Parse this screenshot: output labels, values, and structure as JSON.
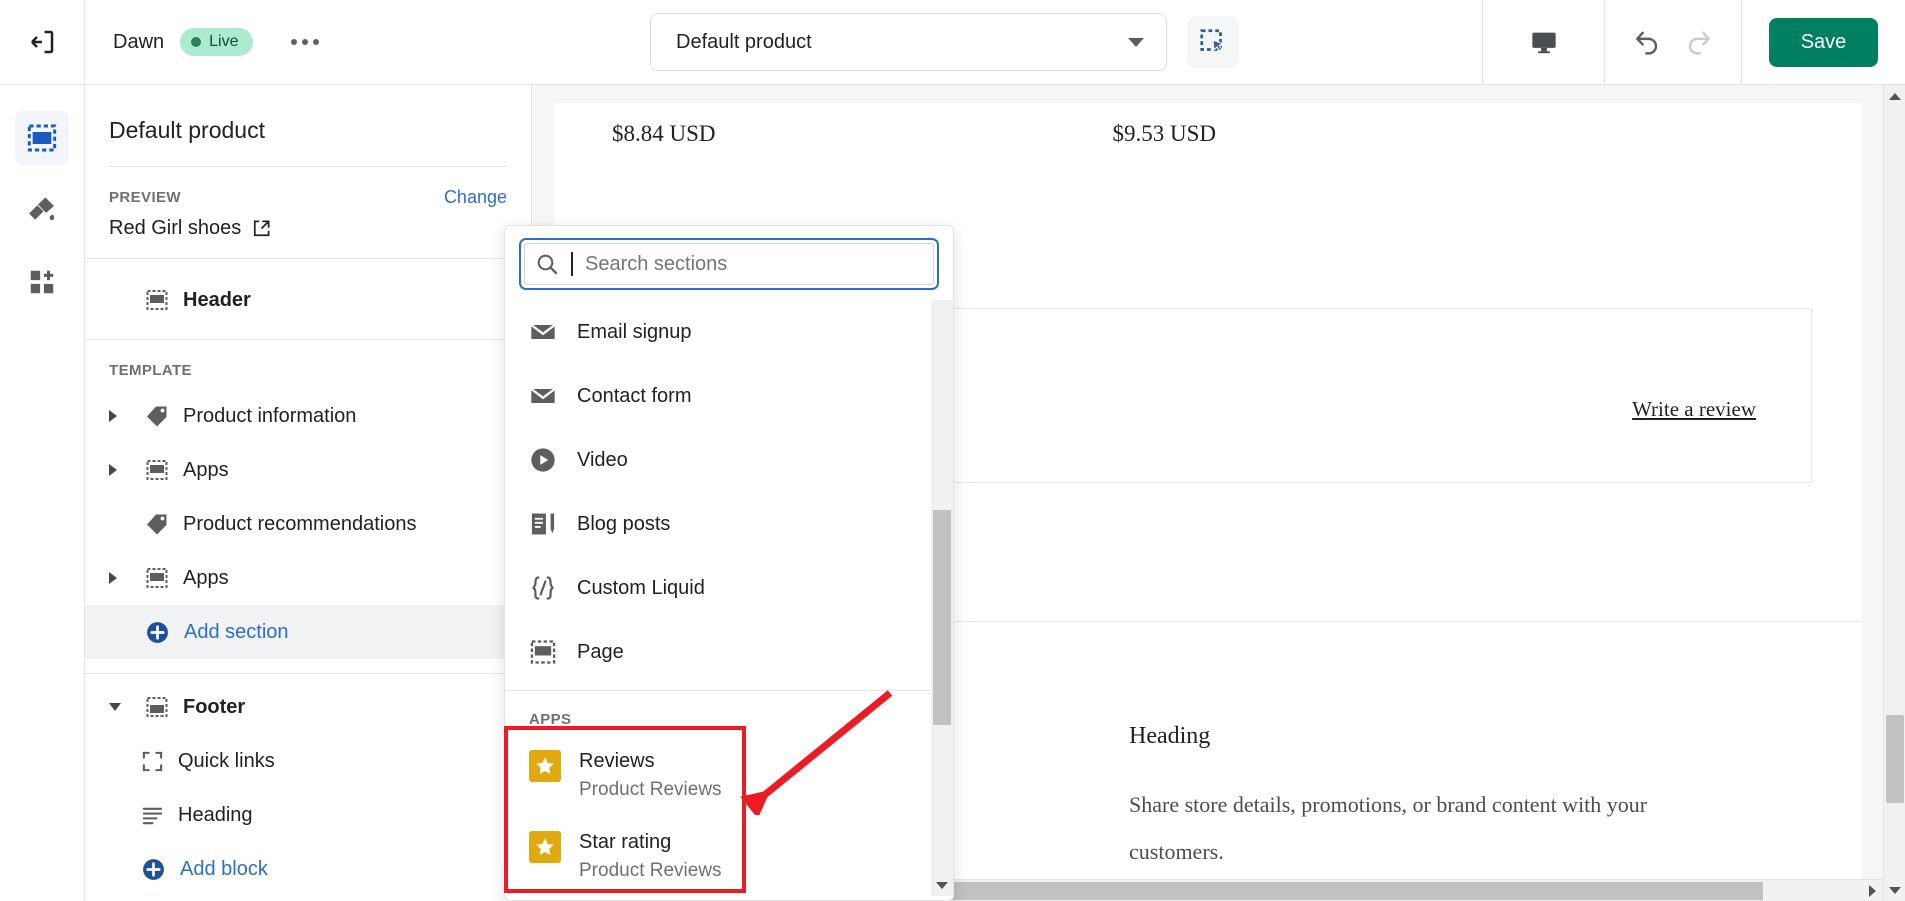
{
  "topbar": {
    "exit_icon": "exit-icon",
    "theme_name": "Dawn",
    "live_badge": "Live",
    "more_icon": "ellipsis-icon",
    "template_selected": "Default product",
    "template_caret": "chevron-down-icon",
    "inspect_icon": "section-select-icon",
    "device_icon": "desktop-icon",
    "undo_icon": "undo-icon",
    "redo_icon": "redo-icon",
    "save_label": "Save",
    "save_color": "#008060"
  },
  "rail": {
    "items": [
      {
        "name": "sections-icon",
        "label": "Sections",
        "active": true
      },
      {
        "name": "paintbrush-icon",
        "label": "Theme settings",
        "active": false
      },
      {
        "name": "apps-grid-icon",
        "label": "App embeds",
        "active": false
      }
    ]
  },
  "sidebar": {
    "title": "Default product",
    "preview_label": "PREVIEW",
    "change_label": "Change",
    "preview_product": "Red Girl shoes",
    "external_icon": "external-link-icon",
    "header_item": "Header",
    "template_label": "TEMPLATE",
    "items": [
      {
        "label": "Product information",
        "icon": "tag-icon",
        "toggle": "right",
        "indent": 0
      },
      {
        "label": "Apps",
        "icon": "section-icon",
        "toggle": "right",
        "indent": 0
      },
      {
        "label": "Product recommendations",
        "icon": "tag-icon",
        "toggle": "none",
        "indent": 0
      },
      {
        "label": "Apps",
        "icon": "section-icon",
        "toggle": "right",
        "indent": 0
      }
    ],
    "add_section_label": "Add section",
    "footer_label": "Footer",
    "footer_blocks": [
      {
        "label": "Quick links",
        "icon": "frame-icon"
      },
      {
        "label": "Heading",
        "icon": "text-lines-icon"
      }
    ],
    "add_block_label": "Add block",
    "link_color": "#2c6ecb"
  },
  "dropdown": {
    "search_placeholder": "Search sections",
    "search_value": "",
    "search_icon": "search-icon",
    "sections": [
      {
        "label": "Email signup",
        "icon": "envelope-icon"
      },
      {
        "label": "Contact form",
        "icon": "envelope-icon"
      },
      {
        "label": "Video",
        "icon": "play-circle-icon"
      },
      {
        "label": "Blog posts",
        "icon": "blog-icon"
      },
      {
        "label": "Custom Liquid",
        "icon": "liquid-code-icon"
      },
      {
        "label": "Page",
        "icon": "section-icon"
      }
    ],
    "apps_label": "APPS",
    "apps": [
      {
        "title": "Reviews",
        "subtitle": "Product Reviews",
        "icon": "star-icon"
      },
      {
        "title": "Star rating",
        "subtitle": "Product Reviews",
        "icon": "star-icon"
      }
    ],
    "star_color": "#e0a811"
  },
  "preview": {
    "price_left": "$8.84 USD",
    "price_right": "$9.53 USD",
    "write_review": "Write a review",
    "heading": "Heading",
    "body": "Share store details, promotions, or brand content with your customers."
  },
  "annotation": {
    "color": "#ed1c24",
    "box_target": "apps-reviews-group",
    "arrow": "pointer-arrow"
  }
}
